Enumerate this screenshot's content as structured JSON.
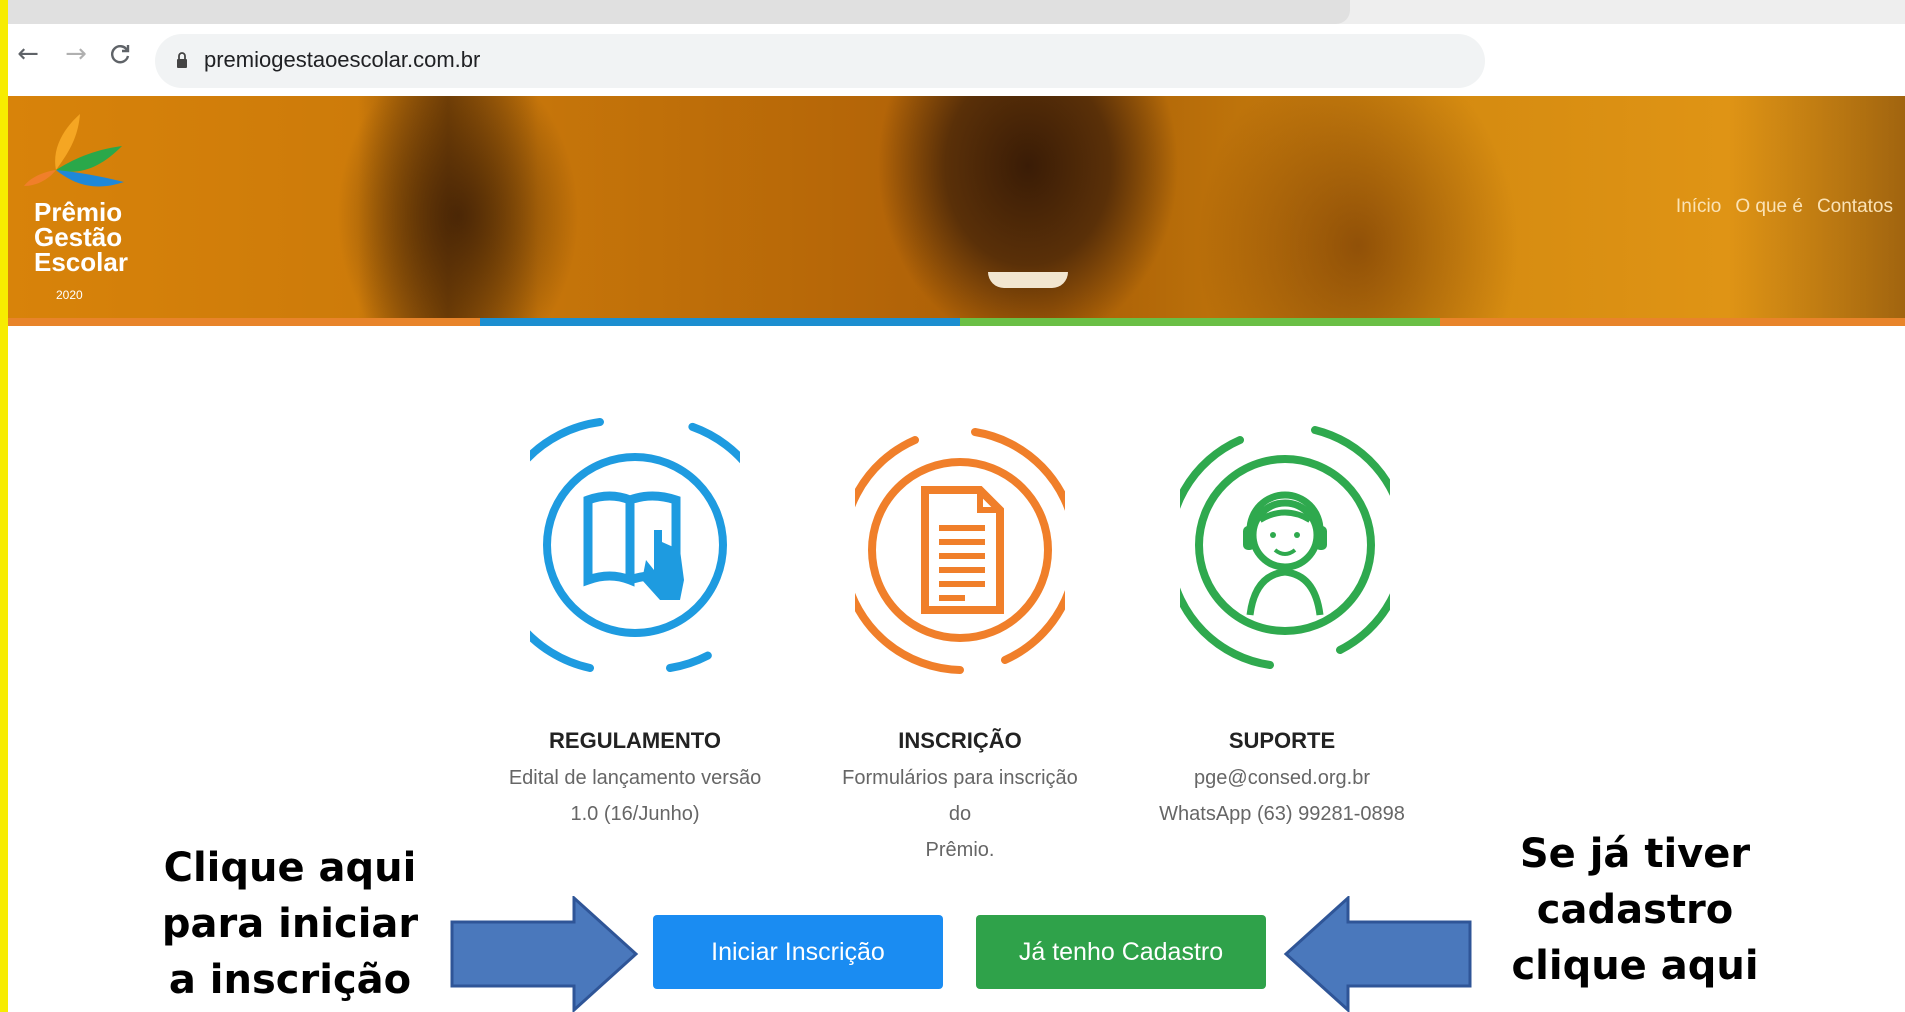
{
  "browser": {
    "url": "premiogestaoescolar.com.br",
    "back_icon": "back-arrow-icon",
    "forward_icon": "forward-arrow-icon",
    "reload_icon": "reload-icon"
  },
  "header": {
    "logo": {
      "line1": "Prêmio",
      "line2": "Gestão",
      "line3": "Escolar",
      "year": "2020"
    },
    "nav": [
      "Início",
      "O que é",
      "Contatos"
    ]
  },
  "colors": {
    "banner_orange": "#d8830a",
    "stripe_orange": "#e8842a",
    "stripe_blue": "#1c8ed0",
    "stripe_green": "#6abf45",
    "regulamento_blue": "#1e9be0",
    "inscricao_orange": "#f07f2a",
    "suporte_green": "#2fa94e",
    "button_blue": "#1a8cf2",
    "button_green": "#2fa24a",
    "arrow_blue": "#4a78bc"
  },
  "cards": [
    {
      "title": "REGULAMENTO",
      "desc1": "Edital de lançamento versão",
      "desc2": "1.0 (16/Junho)",
      "icon": "book-hand-icon"
    },
    {
      "title": "INSCRIÇÃO",
      "desc1": "Formulários para inscrição do",
      "desc2": "Prêmio.",
      "icon": "document-icon"
    },
    {
      "title": "SUPORTE",
      "desc1": "pge@consed.org.br",
      "desc2": "WhatsApp (63) 99281-0898",
      "icon": "headset-support-icon"
    }
  ],
  "buttons": {
    "start": "Iniciar Inscrição",
    "registered": "Já tenho Cadastro"
  },
  "annotations": {
    "left": [
      "Clique aqui",
      "para iniciar",
      "a inscrição"
    ],
    "right": [
      "Se já tiver",
      "cadastro",
      "clique aqui"
    ]
  }
}
